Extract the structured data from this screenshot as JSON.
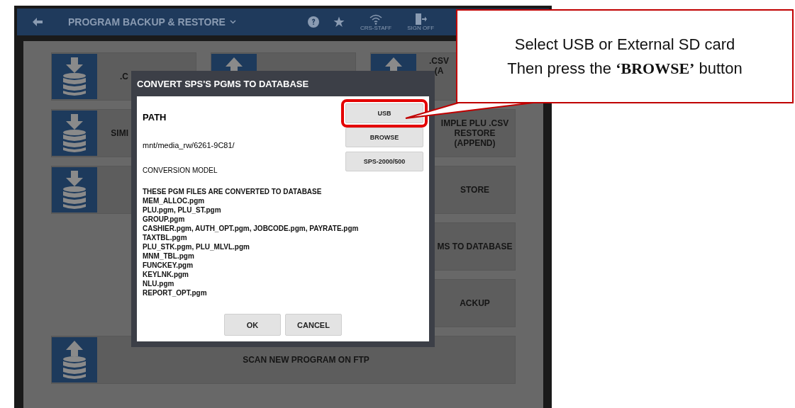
{
  "header": {
    "title": "PROGRAM BACKUP & RESTORE",
    "status_items": [
      {
        "kind": "wifi",
        "label": "CRS-STAFF"
      },
      {
        "kind": "signoff",
        "label": "SIGN OFF"
      }
    ]
  },
  "tiles": [
    {
      "kind": "download",
      "lines": [
        ".C"
      ]
    },
    {
      "kind": "upload"
    },
    {
      "kind": "upload",
      "lines": [
        ".CSV",
        "(A"
      ]
    },
    {
      "kind": "download",
      "lines": [
        "SIMI"
      ]
    },
    {
      "kind": "plain",
      "lines": [
        "IMPLE PLU .CSV",
        "RESTORE",
        "(APPEND)"
      ]
    },
    {
      "kind": "download"
    },
    {
      "kind": "plain",
      "lines": [
        "STORE"
      ]
    },
    {
      "kind": "plain",
      "lines": [
        "MS TO DATABASE"
      ]
    },
    {
      "kind": "plain",
      "lines": [
        "ACKUP"
      ]
    },
    {
      "kind": "upload",
      "lines": [
        "SCAN NEW PROGRAM ON FTP"
      ]
    }
  ],
  "dialog": {
    "title": "CONVERT SPS'S PGMS TO DATABASE",
    "path_label": "PATH",
    "path": "mnt/media_rw/6261-9C81/",
    "model_label": "CONVERSION MODEL",
    "side_buttons": [
      {
        "label": "USB",
        "highlighted": true
      },
      {
        "label": "BROWSE",
        "highlighted": false
      },
      {
        "label": "SPS-2000/500",
        "highlighted": false
      }
    ],
    "files_heading": "THESE PGM FILES ARE CONVERTED TO DATABASE",
    "files": [
      "MEM_ALLOC.pgm",
      "PLU.pgm, PLU_ST.pgm",
      "GROUP.pgm",
      "CASHIER.pgm, AUTH_OPT.pgm, JOBCODE.pgm, PAYRATE.pgm",
      "TAXTBL.pgm",
      "PLU_STK.pgm, PLU_MLVL.pgm",
      "MNM_TBL.pgm",
      "FUNCKEY.pgm",
      "KEYLNK.pgm",
      "NLU.pgm",
      "REPORT_OPT.pgm"
    ],
    "buttons": [
      "OK",
      "CANCEL"
    ]
  },
  "callout": {
    "lines": [
      "Select USB or External SD card",
      "Then press the **‘BROWSE’** button"
    ]
  }
}
